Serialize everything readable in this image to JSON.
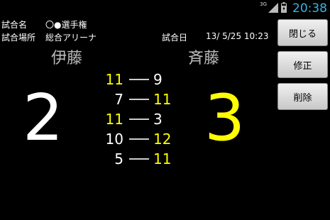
{
  "status_bar": {
    "network": "3G",
    "time": "20:38",
    "icons": [
      "signal-icon",
      "battery-icon"
    ]
  },
  "match": {
    "name_label": "試合名",
    "name_value": "〇●選手権",
    "venue_label": "試合場所",
    "venue_value": "総合アリーナ",
    "date_label": "試合日",
    "date_value": "13/ 5/25 10:23"
  },
  "players": {
    "left": "伊藤",
    "right": "斉藤"
  },
  "totals": {
    "left": "2",
    "right": "3"
  },
  "games": [
    {
      "left": "11",
      "right": "9"
    },
    {
      "left": "7",
      "right": "11"
    },
    {
      "left": "11",
      "right": "3"
    },
    {
      "left": "10",
      "right": "12"
    },
    {
      "left": "5",
      "right": "11"
    }
  ],
  "buttons": {
    "close": "閉じる",
    "edit": "修正",
    "delete": "削除"
  },
  "colors": {
    "winner": "#ffff00",
    "normal": "#ffffff",
    "clock": "#33b5e5",
    "background": "#000000"
  }
}
